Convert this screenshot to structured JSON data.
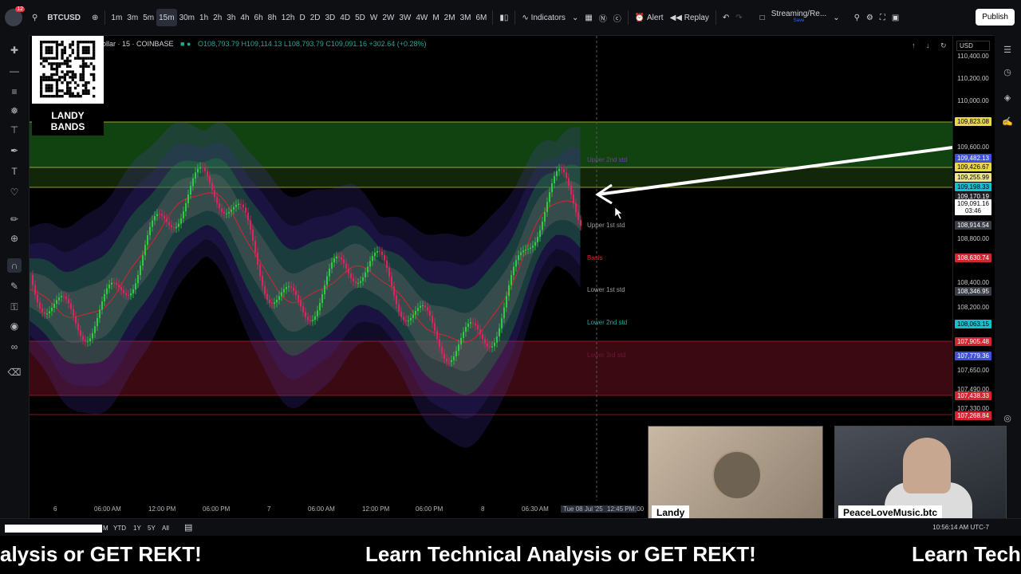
{
  "topbar": {
    "notif_count": "12",
    "symbol": "BTCUSD",
    "intervals": [
      "1m",
      "3m",
      "5m",
      "15m",
      "30m",
      "1h",
      "2h",
      "3h",
      "4h",
      "6h",
      "8h",
      "12h",
      "D",
      "2D",
      "3D",
      "4D",
      "5D",
      "W",
      "2W",
      "3W",
      "4W",
      "M",
      "2M",
      "3M",
      "6M"
    ],
    "active_interval": "15m",
    "indicators_label": "Indicators",
    "alert_label": "Alert",
    "replay_label": "Replay",
    "layout_name": "Streaming/Re...",
    "layout_sub": "Save",
    "publish_label": "Publish"
  },
  "legend": {
    "title": "ollar · 15 · COINBASE",
    "ohlc": "O108,793.79 H109,114.13 L108,793.79 C109,091.16 +302.64 (+0.28%)"
  },
  "qr_caption": {
    "line1": "LANDY",
    "line2": "BANDS"
  },
  "band_labels": {
    "upper2": "Upper 2nd std",
    "upper1": "Upper 1st std",
    "basis": "Basis",
    "lower1": "Lower 1st std",
    "lower2": "Lower 2nd std",
    "lower3": "Lower 3rd std"
  },
  "price_axis": {
    "currency": "USD",
    "labels": [
      {
        "text": "110,400.00",
        "kind": "plain"
      },
      {
        "text": "110,200.00",
        "kind": "plain"
      },
      {
        "text": "110,000.00",
        "kind": "plain"
      },
      {
        "text": "109,823.08",
        "kind": "yellow"
      },
      {
        "text": "109,600.00",
        "kind": "plain"
      },
      {
        "text": "109,482.13",
        "kind": "blue"
      },
      {
        "text": "109,426.67",
        "kind": "yellow"
      },
      {
        "text": "109,255.99",
        "kind": "lightyellow"
      },
      {
        "text": "109,198.33",
        "kind": "cyan"
      },
      {
        "text": "109,170.19",
        "kind": "dark"
      },
      {
        "text": "109,091.16",
        "kind": "white"
      },
      {
        "text": "03:46",
        "kind": "white"
      },
      {
        "text": "108,914.54",
        "kind": "gray"
      },
      {
        "text": "108,800.00",
        "kind": "plain"
      },
      {
        "text": "108,630.74",
        "kind": "red"
      },
      {
        "text": "108,400.00",
        "kind": "plain"
      },
      {
        "text": "108,346.95",
        "kind": "gray"
      },
      {
        "text": "108,200.00",
        "kind": "plain"
      },
      {
        "text": "108,063.15",
        "kind": "cyan"
      },
      {
        "text": "107,905.48",
        "kind": "red"
      },
      {
        "text": "107,779.36",
        "kind": "blue"
      },
      {
        "text": "107,650.00",
        "kind": "plain"
      },
      {
        "text": "107,490.00",
        "kind": "plain"
      },
      {
        "text": "107,438.33",
        "kind": "red"
      },
      {
        "text": "107,330.00",
        "kind": "plain"
      },
      {
        "text": "107,268.84",
        "kind": "red"
      }
    ]
  },
  "time_axis": [
    "6",
    "06:00 AM",
    "12:00 PM",
    "06:00 PM",
    "7",
    "06:00 AM",
    "12:00 PM",
    "06:00 PM",
    "8",
    "06:30 AM",
    "Tue 08 Jul '25",
    "12:45 PM",
    ":00"
  ],
  "bottombar": {
    "ranges": [
      "M",
      "YTD",
      "1Y",
      "5Y",
      "All"
    ],
    "clock": "10:56:14 AM UTC-7"
  },
  "cameras": {
    "left_name": "Landy",
    "right_name": "PeaceLoveMusic.btc"
  },
  "ticker": {
    "text": "Learn Technical Analysis or GET REKT!",
    "left_fragment": "alysis or GET REKT!",
    "right_fragment": "Learn Tech"
  },
  "colors": {
    "up": "#2ecc40",
    "down": "#e0245e",
    "bull_zone": "#1f7a1f",
    "bear_zone": "#6b1020"
  }
}
